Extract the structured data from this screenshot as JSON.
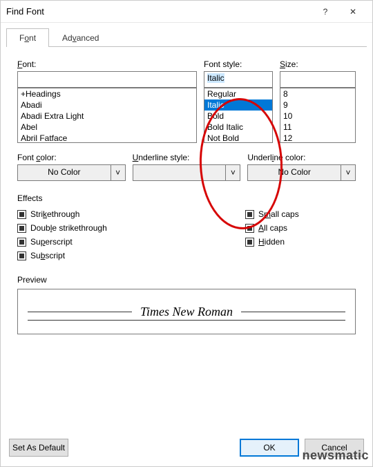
{
  "titlebar": {
    "title": "Find Font",
    "help": "?",
    "close": "✕"
  },
  "tabs": {
    "font": "Font",
    "advanced": "Advanced",
    "font_accel": "o",
    "advanced_accel": "v"
  },
  "font": {
    "label": "Font:",
    "value": "",
    "list": [
      "+Headings",
      "Abadi",
      "Abadi Extra Light",
      "Abel",
      "Abril Fatface"
    ]
  },
  "style": {
    "label": "Font style:",
    "value": "Italic",
    "list": [
      "Regular",
      "Italic",
      "Bold",
      "Bold Italic",
      "Not Bold"
    ],
    "selected_index": 1
  },
  "size": {
    "label": "Size:",
    "value": "",
    "list": [
      "8",
      "9",
      "10",
      "11",
      "12"
    ]
  },
  "color": {
    "label": "Font color:",
    "value": "No Color"
  },
  "underline_style": {
    "label": "Underline style:",
    "value": ""
  },
  "underline_color": {
    "label": "Underline color:",
    "value": "No Color"
  },
  "effects": {
    "heading": "Effects",
    "strikethrough": "Strikethrough",
    "double_strike": "Double strikethrough",
    "superscript": "Superscript",
    "subscript": "Subscript",
    "smallcaps": "Small caps",
    "allcaps": "All caps",
    "hidden": "Hidden"
  },
  "preview": {
    "heading": "Preview",
    "text": "Times New Roman"
  },
  "footer": {
    "default": "Set As Default",
    "ok": "OK",
    "cancel": "Cancel"
  },
  "watermark": "newsmatic"
}
